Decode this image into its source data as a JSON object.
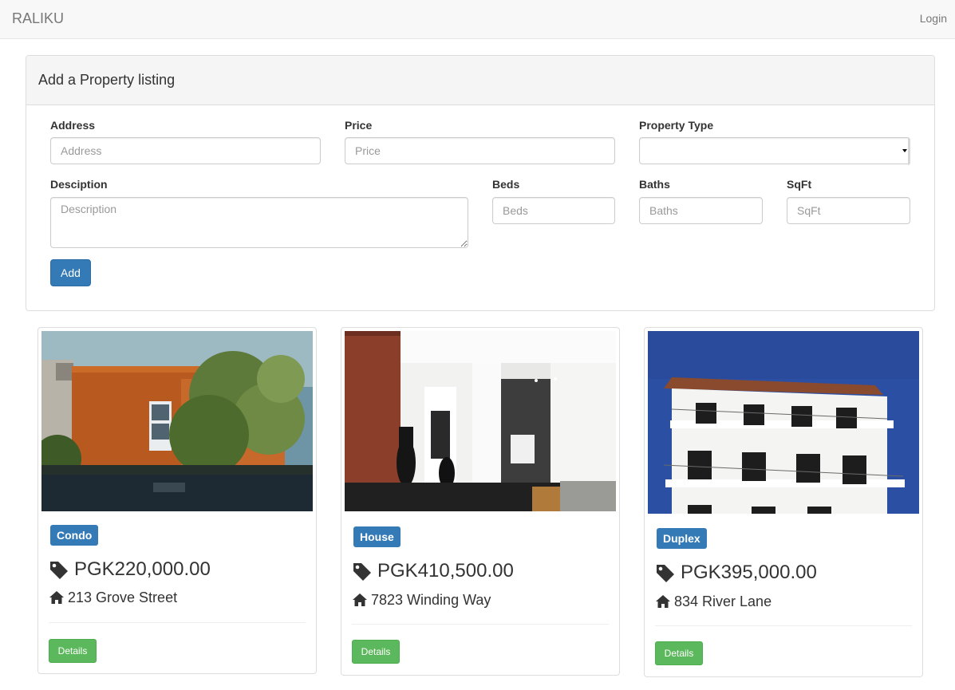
{
  "navbar": {
    "brand": "RALIKU",
    "login": "Login"
  },
  "form": {
    "title": "Add a Property listing",
    "address": {
      "label": "Address",
      "placeholder": "Address",
      "value": ""
    },
    "price": {
      "label": "Price",
      "placeholder": "Price",
      "value": ""
    },
    "property_type": {
      "label": "Property Type",
      "value": ""
    },
    "description": {
      "label": "Desciption",
      "placeholder": "Description",
      "value": ""
    },
    "beds": {
      "label": "Beds",
      "placeholder": "Beds",
      "value": ""
    },
    "baths": {
      "label": "Baths",
      "placeholder": "Baths",
      "value": ""
    },
    "sqft": {
      "label": "SqFt",
      "placeholder": "SqFt",
      "value": ""
    },
    "add_button": "Add"
  },
  "listings": [
    {
      "type": "Condo",
      "price": "PGK220,000.00",
      "address": "213 Grove Street",
      "details_label": "Details",
      "photo_icon": "modern-house-photo"
    },
    {
      "type": "House",
      "price": "PGK410,500.00",
      "address": "7823 Winding Way",
      "details_label": "Details",
      "photo_icon": "interior-photo"
    },
    {
      "type": "Duplex",
      "price": "PGK395,000.00",
      "address": "834 River Lane",
      "details_label": "Details",
      "photo_icon": "apartment-building-photo"
    }
  ],
  "colors": {
    "primary": "#337ab7",
    "success": "#5cb85c",
    "navbar_bg": "#f8f8f8",
    "panel_heading_bg": "#f5f5f5"
  }
}
